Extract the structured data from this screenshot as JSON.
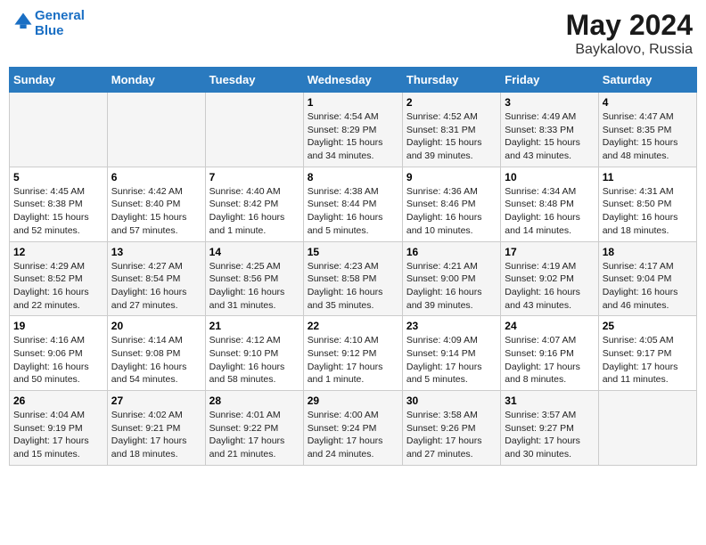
{
  "logo": {
    "line1": "General",
    "line2": "Blue"
  },
  "title": "May 2024",
  "subtitle": "Baykalovo, Russia",
  "days_of_week": [
    "Sunday",
    "Monday",
    "Tuesday",
    "Wednesday",
    "Thursday",
    "Friday",
    "Saturday"
  ],
  "weeks": [
    [
      {
        "day": "",
        "info": ""
      },
      {
        "day": "",
        "info": ""
      },
      {
        "day": "",
        "info": ""
      },
      {
        "day": "1",
        "info": "Sunrise: 4:54 AM\nSunset: 8:29 PM\nDaylight: 15 hours and 34 minutes."
      },
      {
        "day": "2",
        "info": "Sunrise: 4:52 AM\nSunset: 8:31 PM\nDaylight: 15 hours and 39 minutes."
      },
      {
        "day": "3",
        "info": "Sunrise: 4:49 AM\nSunset: 8:33 PM\nDaylight: 15 hours and 43 minutes."
      },
      {
        "day": "4",
        "info": "Sunrise: 4:47 AM\nSunset: 8:35 PM\nDaylight: 15 hours and 48 minutes."
      }
    ],
    [
      {
        "day": "5",
        "info": "Sunrise: 4:45 AM\nSunset: 8:38 PM\nDaylight: 15 hours and 52 minutes."
      },
      {
        "day": "6",
        "info": "Sunrise: 4:42 AM\nSunset: 8:40 PM\nDaylight: 15 hours and 57 minutes."
      },
      {
        "day": "7",
        "info": "Sunrise: 4:40 AM\nSunset: 8:42 PM\nDaylight: 16 hours and 1 minute."
      },
      {
        "day": "8",
        "info": "Sunrise: 4:38 AM\nSunset: 8:44 PM\nDaylight: 16 hours and 5 minutes."
      },
      {
        "day": "9",
        "info": "Sunrise: 4:36 AM\nSunset: 8:46 PM\nDaylight: 16 hours and 10 minutes."
      },
      {
        "day": "10",
        "info": "Sunrise: 4:34 AM\nSunset: 8:48 PM\nDaylight: 16 hours and 14 minutes."
      },
      {
        "day": "11",
        "info": "Sunrise: 4:31 AM\nSunset: 8:50 PM\nDaylight: 16 hours and 18 minutes."
      }
    ],
    [
      {
        "day": "12",
        "info": "Sunrise: 4:29 AM\nSunset: 8:52 PM\nDaylight: 16 hours and 22 minutes."
      },
      {
        "day": "13",
        "info": "Sunrise: 4:27 AM\nSunset: 8:54 PM\nDaylight: 16 hours and 27 minutes."
      },
      {
        "day": "14",
        "info": "Sunrise: 4:25 AM\nSunset: 8:56 PM\nDaylight: 16 hours and 31 minutes."
      },
      {
        "day": "15",
        "info": "Sunrise: 4:23 AM\nSunset: 8:58 PM\nDaylight: 16 hours and 35 minutes."
      },
      {
        "day": "16",
        "info": "Sunrise: 4:21 AM\nSunset: 9:00 PM\nDaylight: 16 hours and 39 minutes."
      },
      {
        "day": "17",
        "info": "Sunrise: 4:19 AM\nSunset: 9:02 PM\nDaylight: 16 hours and 43 minutes."
      },
      {
        "day": "18",
        "info": "Sunrise: 4:17 AM\nSunset: 9:04 PM\nDaylight: 16 hours and 46 minutes."
      }
    ],
    [
      {
        "day": "19",
        "info": "Sunrise: 4:16 AM\nSunset: 9:06 PM\nDaylight: 16 hours and 50 minutes."
      },
      {
        "day": "20",
        "info": "Sunrise: 4:14 AM\nSunset: 9:08 PM\nDaylight: 16 hours and 54 minutes."
      },
      {
        "day": "21",
        "info": "Sunrise: 4:12 AM\nSunset: 9:10 PM\nDaylight: 16 hours and 58 minutes."
      },
      {
        "day": "22",
        "info": "Sunrise: 4:10 AM\nSunset: 9:12 PM\nDaylight: 17 hours and 1 minute."
      },
      {
        "day": "23",
        "info": "Sunrise: 4:09 AM\nSunset: 9:14 PM\nDaylight: 17 hours and 5 minutes."
      },
      {
        "day": "24",
        "info": "Sunrise: 4:07 AM\nSunset: 9:16 PM\nDaylight: 17 hours and 8 minutes."
      },
      {
        "day": "25",
        "info": "Sunrise: 4:05 AM\nSunset: 9:17 PM\nDaylight: 17 hours and 11 minutes."
      }
    ],
    [
      {
        "day": "26",
        "info": "Sunrise: 4:04 AM\nSunset: 9:19 PM\nDaylight: 17 hours and 15 minutes."
      },
      {
        "day": "27",
        "info": "Sunrise: 4:02 AM\nSunset: 9:21 PM\nDaylight: 17 hours and 18 minutes."
      },
      {
        "day": "28",
        "info": "Sunrise: 4:01 AM\nSunset: 9:22 PM\nDaylight: 17 hours and 21 minutes."
      },
      {
        "day": "29",
        "info": "Sunrise: 4:00 AM\nSunset: 9:24 PM\nDaylight: 17 hours and 24 minutes."
      },
      {
        "day": "30",
        "info": "Sunrise: 3:58 AM\nSunset: 9:26 PM\nDaylight: 17 hours and 27 minutes."
      },
      {
        "day": "31",
        "info": "Sunrise: 3:57 AM\nSunset: 9:27 PM\nDaylight: 17 hours and 30 minutes."
      },
      {
        "day": "",
        "info": ""
      }
    ]
  ]
}
